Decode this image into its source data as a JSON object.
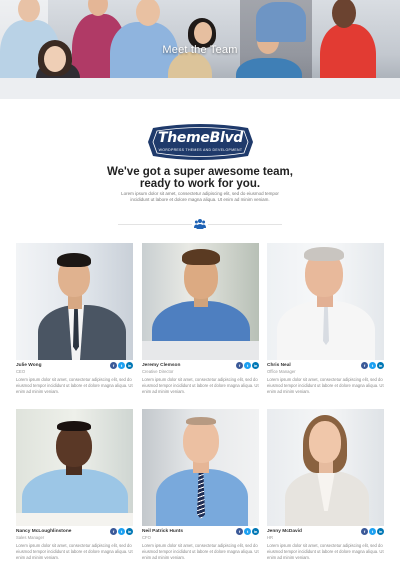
{
  "hero": {
    "title": "Meet the Team"
  },
  "logo": {
    "text": "ThemeBlvd",
    "tagline": "WORDPRESS THEMES AND DEVELOPMENT"
  },
  "intro": {
    "headline_line1": "We've got a super awesome team,",
    "headline_line2": "ready to work for you.",
    "body": "Lorem ipsum dolor sit amet, consectetur adipiscing elit, sed do eiusmod tempor incididunt ut labore et dolore magna aliqua. Ut enim ad minim veniam."
  },
  "colors": {
    "brand_navy": "#1f3a6b",
    "facebook": "#3b5998",
    "twitter": "#1da1f2",
    "linkedin": "#0077b5"
  },
  "social_icons": [
    "facebook-icon",
    "twitter-icon",
    "linkedin-icon"
  ],
  "team": [
    {
      "name": "Julie Wong",
      "role": "CEO",
      "bio": "Lorem ipsum dolor sit amet, consectetur adipiscing elit, sed do eiusmod tempor incididunt ut labore et dolore magna aliqua. Ut enim ad minim veniam."
    },
    {
      "name": "Jeremy Clemson",
      "role": "Creative Director",
      "bio": "Lorem ipsum dolor sit amet, consectetur adipiscing elit, sed do eiusmod tempor incididunt ut labore et dolore magna aliqua. Ut enim ad minim veniam."
    },
    {
      "name": "Chris Neal",
      "role": "Office Manager",
      "bio": "Lorem ipsum dolor sit amet, consectetur adipiscing elit, sed do eiusmod tempor incididunt ut labore et dolore magna aliqua. Ut enim ad minim veniam."
    },
    {
      "name": "Nancy McLoughlinstone",
      "role": "Sales Manager",
      "bio": "Lorem ipsum dolor sit amet, consectetur adipiscing elit, sed do eiusmod tempor incididunt ut labore et dolore magna aliqua. Ut enim ad minim veniam."
    },
    {
      "name": "Neil Patrick Hunts",
      "role": "CFO",
      "bio": "Lorem ipsum dolor sit amet, consectetur adipiscing elit, sed do eiusmod tempor incididunt ut labore et dolore magna aliqua. Ut enim ad minim veniam."
    },
    {
      "name": "Jenny McDavid",
      "role": "HR",
      "bio": "Lorem ipsum dolor sit amet, consectetur adipiscing elit, sed do eiusmod tempor incididunt ut labore et dolore magna aliqua. Ut enim ad minim veniam."
    }
  ]
}
